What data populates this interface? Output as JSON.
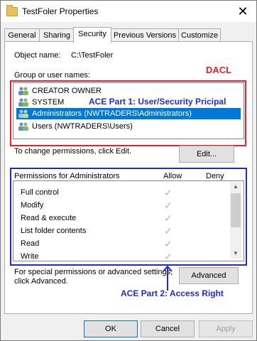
{
  "window": {
    "title": "TestFoler Properties"
  },
  "tabs": [
    {
      "label": "General"
    },
    {
      "label": "Sharing"
    },
    {
      "label": "Security"
    },
    {
      "label": "Previous Versions"
    },
    {
      "label": "Customize"
    }
  ],
  "object": {
    "label": "Object name:",
    "value": "C:\\TestFoler"
  },
  "groups": {
    "label": "Group or user names:",
    "items": [
      {
        "name": "CREATOR OWNER"
      },
      {
        "name": "SYSTEM"
      },
      {
        "name": "Administrators (NWTRADERS\\Administrators)"
      },
      {
        "name": "Users (NWTRADERS\\Users)"
      }
    ],
    "selected_index": 2
  },
  "change_text": "To change permissions, click Edit.",
  "edit_button": "Edit...",
  "permissions": {
    "header": "Permissions for Administrators",
    "allow": "Allow",
    "deny": "Deny",
    "rows": [
      {
        "name": "Full control"
      },
      {
        "name": "Modify"
      },
      {
        "name": "Read & execute"
      },
      {
        "name": "List folder contents"
      },
      {
        "name": "Read"
      },
      {
        "name": "Write"
      }
    ]
  },
  "special_text_1": "For special permissions or advanced settings,",
  "special_text_2": "click Advanced.",
  "advanced_button": "Advanced",
  "footer": {
    "ok": "OK",
    "cancel": "Cancel",
    "apply": "Apply"
  },
  "annotations": {
    "dacl": "DACL",
    "ace1": "ACE Part 1: User/Security Pricipal",
    "ace2": "ACE Part 2: Access Right",
    "red": "#e8202a",
    "blue": "#1f2ccb"
  }
}
